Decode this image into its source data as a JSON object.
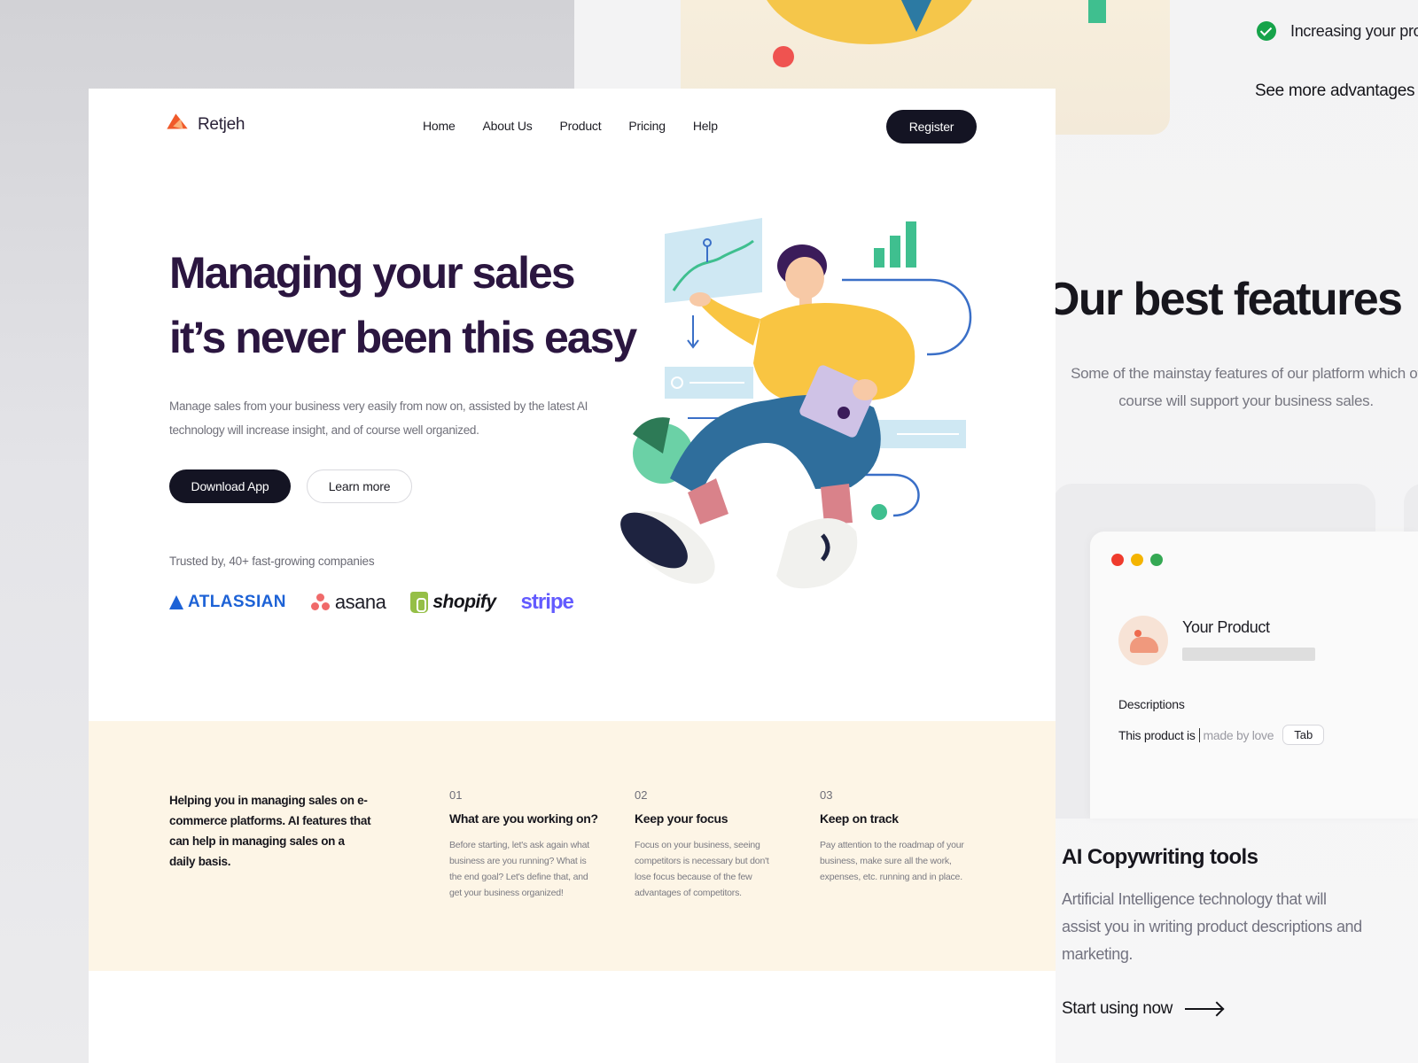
{
  "brand": {
    "name": "Retjeh"
  },
  "nav": {
    "items": [
      "Home",
      "About Us",
      "Product",
      "Pricing",
      "Help"
    ],
    "register_label": "Register"
  },
  "hero": {
    "title_line1": "Managing your sales",
    "title_line2": "it’s never been this easy",
    "description": "Manage sales from your business very easily from now on, assisted by the latest AI technology will increase insight, and of course well organized.",
    "primary_cta": "Download App",
    "secondary_cta": "Learn more",
    "trusted_text": "Trusted by, 40+ fast-growing companies",
    "logos": [
      "ATLASSIAN",
      "asana",
      "shopify",
      "stripe"
    ]
  },
  "band": {
    "intro": "Helping you in managing sales on e-commerce platforms. AI features that can help in managing sales on a daily basis.",
    "steps": [
      {
        "num": "01",
        "title": "What are you working on?",
        "desc": "Before starting, let's ask again what business are you running? What is the end goal? Let's define that, and get your business organized!"
      },
      {
        "num": "02",
        "title": "Keep your focus",
        "desc": "Focus on your business, seeing competitors is necessary but don't lose focus because of the few advantages of competitors."
      },
      {
        "num": "03",
        "title": "Keep on track",
        "desc": "Pay attention to the roadmap of your business, make sure all the work, expenses, etc. running and in place."
      }
    ]
  },
  "side": {
    "advantage_text": "Increasing your pro",
    "see_more": "See more advantages",
    "features_title": "Our best features",
    "features_sub": "Some of the mainstay features of our platform which of course will support your business sales.",
    "product_title": "Your Product",
    "descriptions_label": "Descriptions",
    "typed_text": "This product is",
    "suggestion_text": "made by love",
    "tab_key": "Tab",
    "ai_title": "AI Copywriting tools",
    "ai_desc": "Artificial Intelligence technology that will assist you in writing product descriptions and marketing.",
    "start_link": "Start using now"
  },
  "colors": {
    "primary_dark": "#141423",
    "heading_purple": "#2b1640",
    "band_cream": "#fdf5e6",
    "window_dots": [
      "#ef3b2d",
      "#f4b400",
      "#34a853"
    ]
  }
}
